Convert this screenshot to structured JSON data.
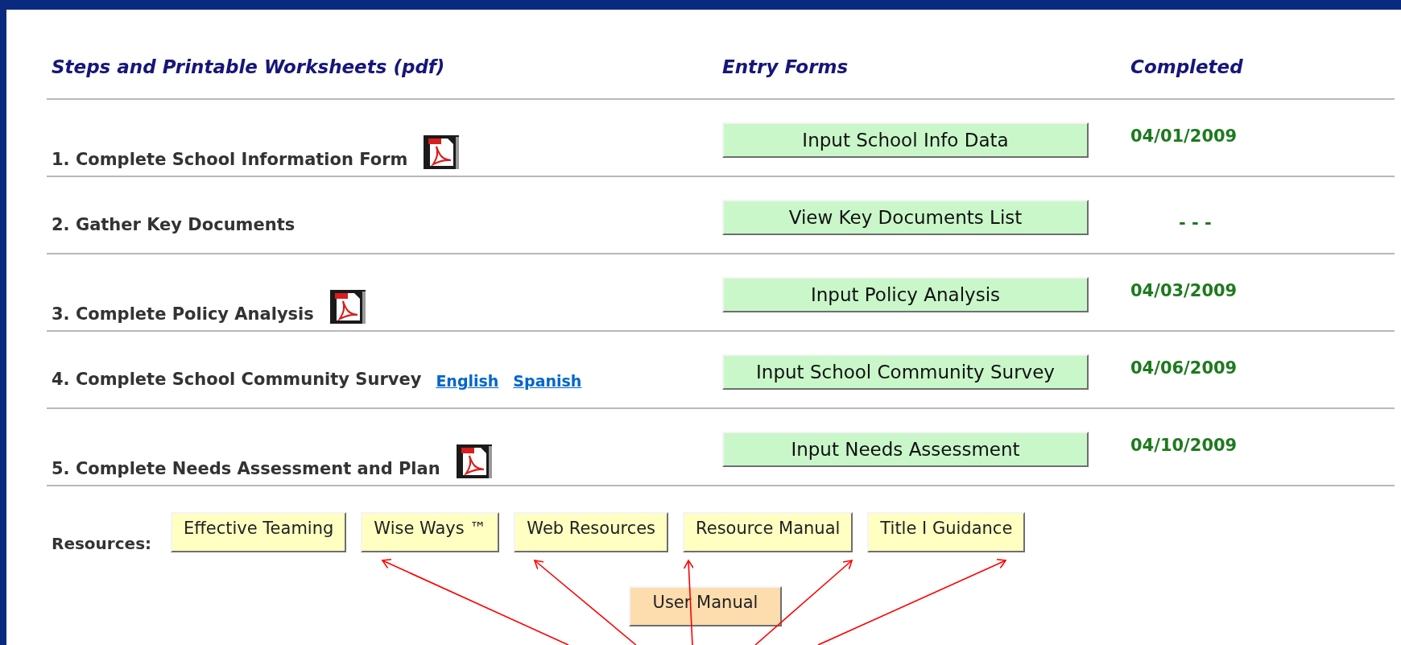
{
  "table": {
    "columns": [
      "Steps and Printable Worksheets (pdf)",
      "Entry Forms",
      "Completed"
    ],
    "rows": [
      {
        "step": "1. Complete School Information Form",
        "attachments": [
          {
            "kind": "pdf"
          }
        ],
        "button": "Input School Info Data",
        "completed": "04/01/2009"
      },
      {
        "step": "2. Gather Key Documents",
        "attachments": [],
        "button": "View Key Documents List",
        "completed": "- - -"
      },
      {
        "step": "3. Complete Policy Analysis",
        "attachments": [
          {
            "kind": "pdf"
          }
        ],
        "button": "Input Policy Analysis",
        "completed": "04/03/2009"
      },
      {
        "step": "4. Complete School Community Survey",
        "attachments": [
          {
            "kind": "link",
            "text": "English"
          },
          {
            "kind": "link",
            "text": "Spanish"
          }
        ],
        "button": "Input School Community Survey",
        "completed": "04/06/2009"
      },
      {
        "step": "5. Complete Needs Assessment and Plan",
        "attachments": [
          {
            "kind": "pdf"
          }
        ],
        "button": "Input Needs Assessment",
        "completed": "04/10/2009"
      }
    ]
  },
  "resources": {
    "label": "Resources:",
    "buttons": [
      "Effective Teaming",
      "Wise Ways ™",
      "Web Resources",
      "Resource Manual",
      "Title I Guidance"
    ],
    "extra_button": "User Manual"
  },
  "annotation": {
    "arrows": [
      {
        "kind": "arrow"
      },
      {
        "kind": "arrow"
      },
      {
        "kind": "arrow"
      },
      {
        "kind": "arrow"
      },
      {
        "kind": "arrow"
      }
    ]
  }
}
